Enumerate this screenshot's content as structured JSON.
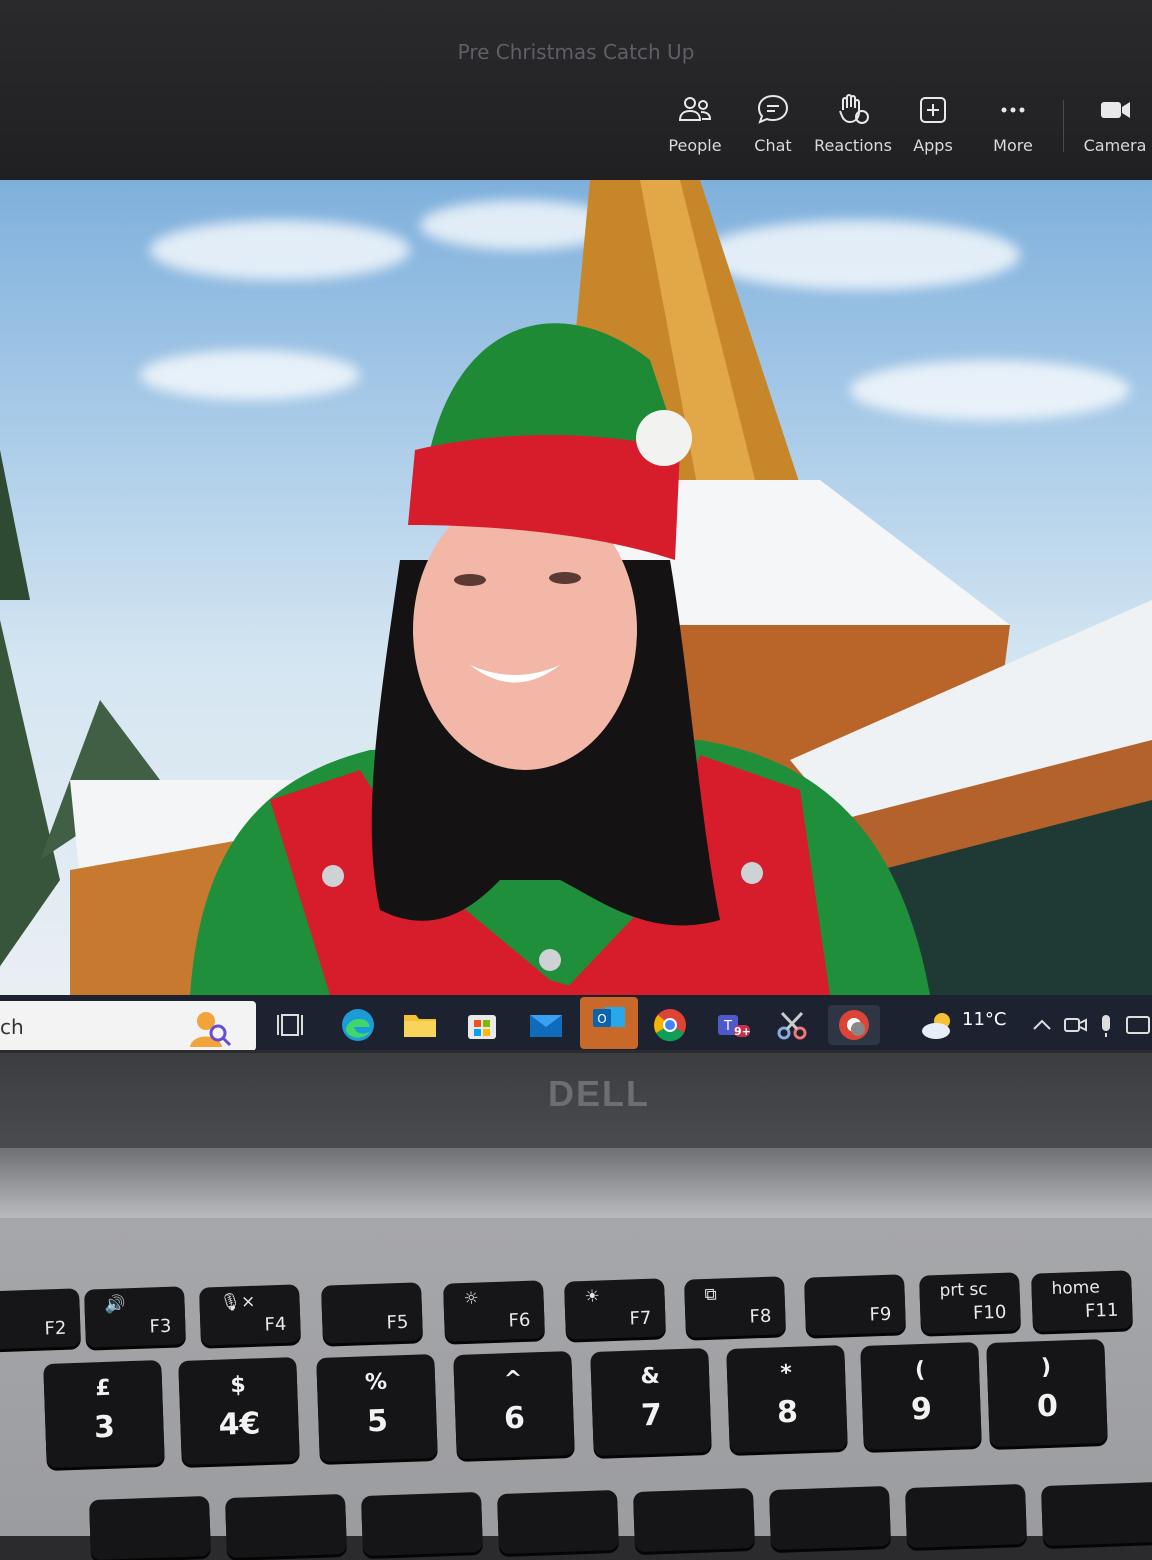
{
  "window": {
    "title": "Pre Christmas Catch Up"
  },
  "toolbar": {
    "people": "People",
    "chat": "Chat",
    "reactions": "Reactions",
    "apps": "Apps",
    "more": "More",
    "camera": "Camera"
  },
  "taskbar": {
    "search_text": "ch",
    "teams_badge": "9+",
    "weather_temp": "11°C"
  },
  "laptop": {
    "brand": "DELL",
    "function_keys": [
      {
        "label": "F2",
        "top": ""
      },
      {
        "label": "F3",
        "top": "🔊"
      },
      {
        "label": "F4",
        "top": "🎙×"
      },
      {
        "label": "F5",
        "top": ""
      },
      {
        "label": "F6",
        "top": "☼"
      },
      {
        "label": "F7",
        "top": "☀"
      },
      {
        "label": "F8",
        "top": "⧉"
      },
      {
        "label": "F9",
        "top": ""
      },
      {
        "label": "F10",
        "top": "prt sc"
      },
      {
        "label": "F11",
        "top": "home"
      }
    ],
    "number_keys": [
      {
        "top": "£",
        "bottom": "3"
      },
      {
        "top": "$",
        "bottom": "4€"
      },
      {
        "top": "%",
        "bottom": "5"
      },
      {
        "top": "^",
        "bottom": "6"
      },
      {
        "top": "&",
        "bottom": "7"
      },
      {
        "top": "*",
        "bottom": "8"
      },
      {
        "top": "(",
        "bottom": "9"
      },
      {
        "top": ")",
        "bottom": "0"
      }
    ]
  },
  "colors": {
    "elf_green": "#1e8f3a",
    "elf_red": "#d81c2c",
    "teams_bar": "#242428"
  }
}
